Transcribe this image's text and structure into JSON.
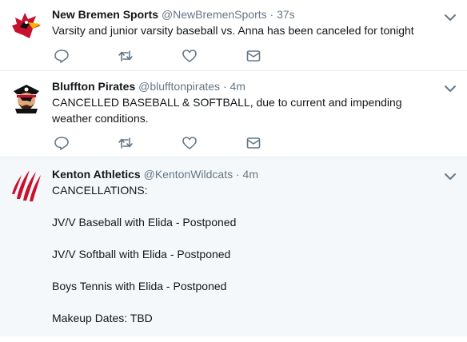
{
  "tweets": [
    {
      "name": "New Bremen Sports",
      "handle": "@NewBremenSports",
      "dot": "·",
      "time": "37s",
      "lines": [
        "Varsity and junior varsity baseball vs. Anna has been canceled for tonight"
      ]
    },
    {
      "name": "Bluffton Pirates",
      "handle": "@blufftonpirates",
      "dot": "·",
      "time": "4m",
      "lines": [
        "CANCELLED BASEBALL & SOFTBALL, due to current and impending weather conditions."
      ]
    },
    {
      "name": "Kenton Athletics",
      "handle": "@KentonWildcats",
      "dot": "·",
      "time": "4m",
      "lines": [
        "CANCELLATIONS:",
        "JV/V Baseball with Elida - Postponed",
        "JV/V Softball with Elida - Postponed",
        "Boys Tennis with Elida - Postponed",
        "Makeup Dates: TBD"
      ]
    }
  ],
  "icons": {
    "reply": "reply-icon",
    "retweet": "retweet-icon",
    "like": "like-icon",
    "dm": "direct-message-icon",
    "caret": "chevron-down-icon"
  },
  "colors": {
    "icon_gray": "#657786",
    "divider": "#e6ecf0",
    "highlight_bg": "#f5f8fa"
  }
}
